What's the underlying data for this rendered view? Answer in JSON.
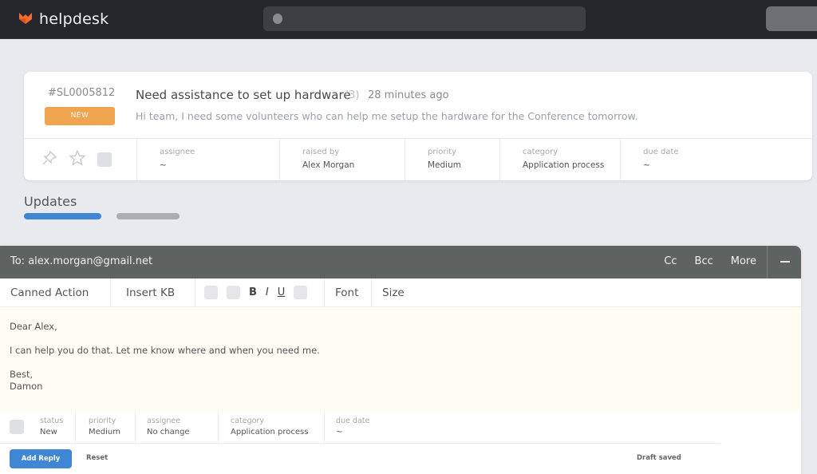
{
  "app": {
    "name": "helpdesk",
    "brand_color": "#f26d2b",
    "icons": {
      "logo": "fox-logo-icon",
      "search": "search-dot-icon"
    }
  },
  "ticket": {
    "id": "#SL0005812",
    "status_badge": "NEW",
    "title": "Need assistance to set up hardware",
    "reply_count": "(3)",
    "time": "28 minutes ago",
    "description": "Hi team, I need some volunteers who can help me setup the hardware for the Conference tomorrow.",
    "icons": [
      "pin-icon",
      "star-icon",
      "checkbox-icon"
    ],
    "meta": [
      {
        "label": "assignee",
        "value": "~"
      },
      {
        "label": "raised by",
        "value": "Alex Morgan"
      },
      {
        "label": "priority",
        "value": "Medium"
      },
      {
        "label": "category",
        "value": "Application process"
      },
      {
        "label": "due date",
        "value": "~"
      }
    ]
  },
  "updates": {
    "title": "Updates"
  },
  "composer": {
    "to": "To: alex.morgan@gmail.net",
    "cc": "Cc",
    "bcc": "Bcc",
    "more": "More",
    "toolbar": {
      "canned_action": "Canned Action",
      "insert_kb": "Insert KB",
      "bold": "B",
      "italic": "I",
      "underline": "U",
      "font": "Font",
      "size": "Size"
    },
    "body": {
      "greeting": "Dear Alex,",
      "message": "I can help you do that. Let me know where and when you need me.",
      "closing": "Best,",
      "signature": "Damon"
    },
    "reply_meta": [
      {
        "label": "status",
        "value": "New"
      },
      {
        "label": "priority",
        "value": "Medium"
      },
      {
        "label": "assignee",
        "value": "No change"
      },
      {
        "label": "category",
        "value": "Application process"
      },
      {
        "label": "due date",
        "value": "~"
      }
    ],
    "add_reply": "Add Reply",
    "reset": "Reset",
    "draft_status": "Draft saved"
  }
}
